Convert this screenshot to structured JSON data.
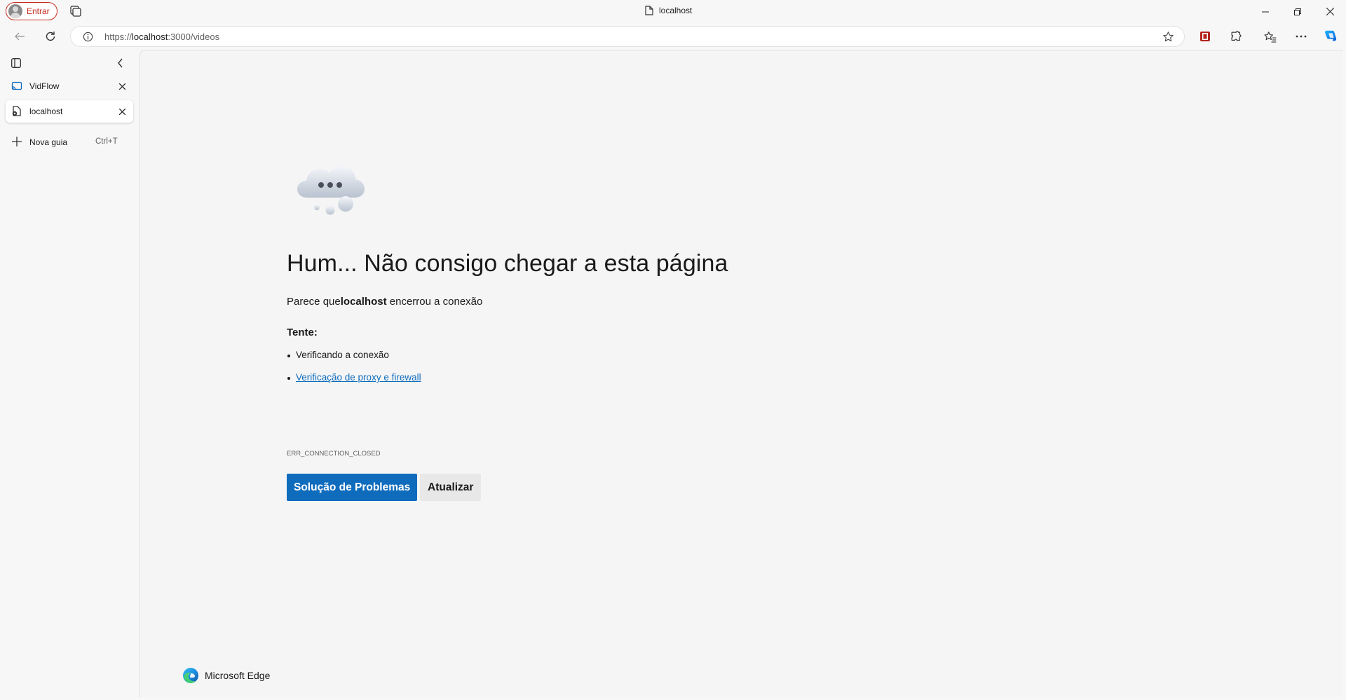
{
  "titlebar": {
    "profile_label": "Entrar",
    "page_title": "localhost"
  },
  "navbar": {
    "url_scheme": "https://",
    "url_host": "localhost",
    "url_path": ":3000/videos"
  },
  "sidebar": {
    "tabs": [
      {
        "label": "VidFlow",
        "active": false
      },
      {
        "label": "localhost",
        "active": true
      }
    ],
    "new_tab_label": "Nova guia",
    "new_tab_shortcut": "Ctrl+T"
  },
  "error_page": {
    "title": "Hum... Não consigo chegar a esta página",
    "subtitle_prefix": "Parece que",
    "subtitle_host": "localhost",
    "subtitle_suffix": " encerrou a conexão",
    "try_label": "Tente:",
    "suggestions": [
      {
        "text": "Verificando a conexão",
        "link": false
      },
      {
        "text": "Verificação de proxy e firewall",
        "link": true
      }
    ],
    "error_code": "ERR_CONNECTION_CLOSED",
    "primary_button": "Solução de Problemas",
    "secondary_button": "Atualizar",
    "brand": "Microsoft Edge"
  },
  "colors": {
    "accent": "#0f6cbd",
    "profile_border": "#c42b1c"
  }
}
